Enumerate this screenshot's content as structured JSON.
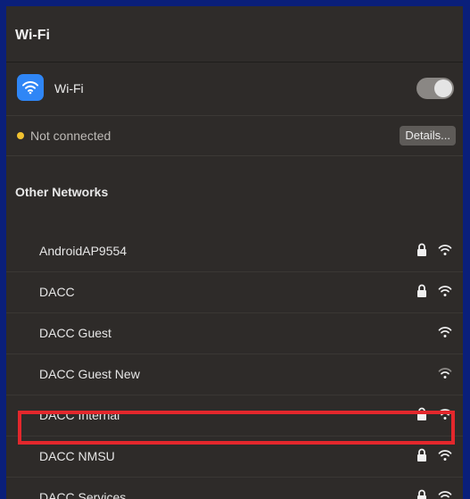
{
  "header": {
    "title": "Wi-Fi"
  },
  "wifi_toggle_row": {
    "icon": "wifi-app-icon",
    "label": "Wi-Fi",
    "toggle_state": "on"
  },
  "status_row": {
    "status_color": "#f2c230",
    "status_text": "Not connected",
    "details_label": "Details..."
  },
  "other_networks": {
    "section_label": "Other Networks",
    "networks": [
      {
        "name": "AndroidAP9554",
        "locked": true
      },
      {
        "name": "DACC",
        "locked": true
      },
      {
        "name": "DACC Guest",
        "locked": false
      },
      {
        "name": "DACC Guest New",
        "locked": false
      },
      {
        "name": "DACC Internal",
        "locked": true
      },
      {
        "name": "DACC NMSU",
        "locked": true
      },
      {
        "name": "DACC Services",
        "locked": true
      }
    ]
  },
  "colors": {
    "frame": "#0a1f7a",
    "panel": "#2e2b29",
    "accent_blue": "#2f86f6",
    "highlight_red": "#e3272c"
  }
}
